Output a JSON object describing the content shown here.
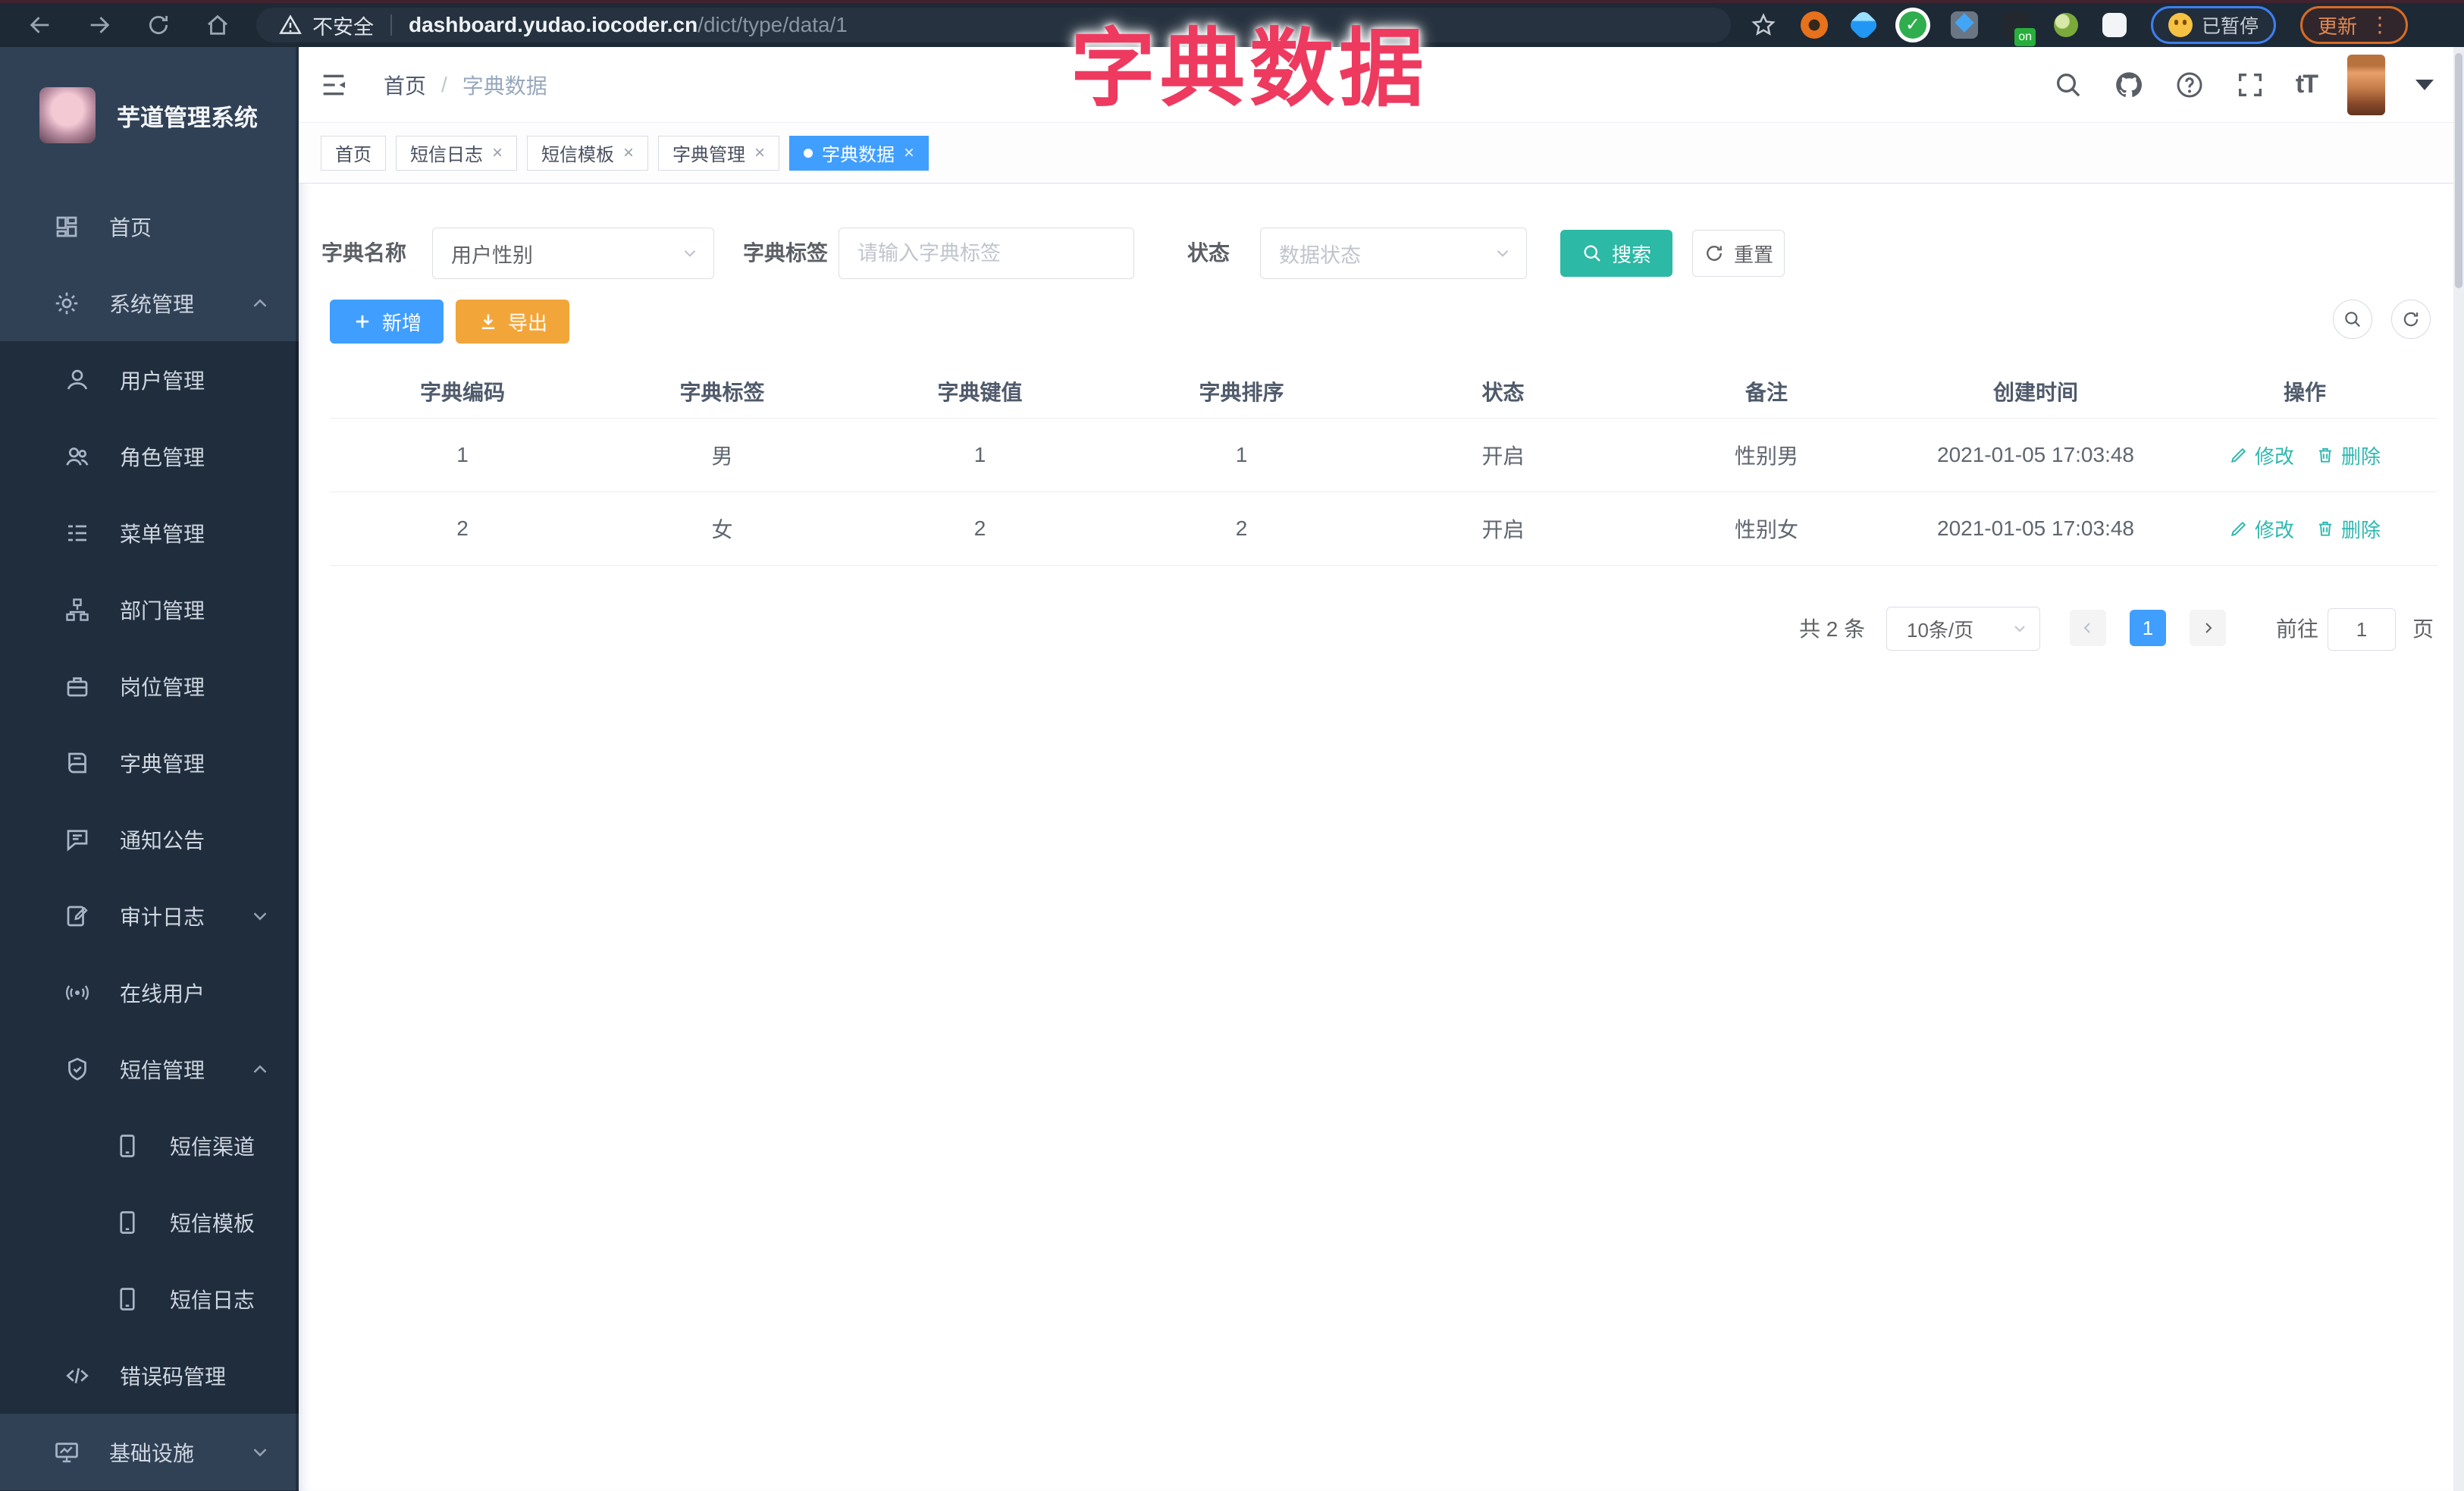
{
  "overlay_title": "字典数据",
  "browser": {
    "security": "不安全",
    "host": "dashboard.yudao.iocoder.cn",
    "path": "/dict/type/data/1",
    "paused": "已暂停",
    "update": "更新",
    "on_badge": "on"
  },
  "sidebar": {
    "title": "芋道管理系统",
    "items": [
      {
        "label": "首页"
      },
      {
        "label": "系统管理"
      },
      {
        "label": "用户管理"
      },
      {
        "label": "角色管理"
      },
      {
        "label": "菜单管理"
      },
      {
        "label": "部门管理"
      },
      {
        "label": "岗位管理"
      },
      {
        "label": "字典管理"
      },
      {
        "label": "通知公告"
      },
      {
        "label": "审计日志"
      },
      {
        "label": "在线用户"
      },
      {
        "label": "短信管理"
      },
      {
        "label": "短信渠道"
      },
      {
        "label": "短信模板"
      },
      {
        "label": "短信日志"
      },
      {
        "label": "错误码管理"
      },
      {
        "label": "基础设施"
      }
    ]
  },
  "header": {
    "breadcrumb_home": "首页",
    "breadcrumb_sep": "/",
    "breadcrumb_current": "字典数据"
  },
  "tabs": [
    {
      "label": "首页"
    },
    {
      "label": "短信日志"
    },
    {
      "label": "短信模板"
    },
    {
      "label": "字典管理"
    },
    {
      "label": "字典数据"
    }
  ],
  "filters": {
    "name_label": "字典名称",
    "name_value": "用户性别",
    "tag_label": "字典标签",
    "tag_placeholder": "请输入字典标签",
    "status_label": "状态",
    "status_placeholder": "数据状态",
    "search_label": "搜索",
    "reset_label": "重置"
  },
  "toolbar": {
    "add_label": "新增",
    "export_label": "导出"
  },
  "table": {
    "headers": [
      "字典编码",
      "字典标签",
      "字典键值",
      "字典排序",
      "状态",
      "备注",
      "创建时间",
      "操作"
    ],
    "rows": [
      {
        "code": "1",
        "tag": "男",
        "value": "1",
        "sort": "1",
        "status": "开启",
        "remark": "性别男",
        "created": "2021-01-05 17:03:48"
      },
      {
        "code": "2",
        "tag": "女",
        "value": "2",
        "sort": "2",
        "status": "开启",
        "remark": "性别女",
        "created": "2021-01-05 17:03:48"
      }
    ],
    "edit_label": "修改",
    "delete_label": "删除"
  },
  "pagination": {
    "total": "共 2 条",
    "page_size": "10条/页",
    "page": "1",
    "goto_label": "前往",
    "goto_value": "1",
    "page_unit": "页"
  },
  "colors": {
    "accent": "#409eff",
    "search_button": "#2cb9a5",
    "export_button": "#f2a63a",
    "action_link": "#2eb8b0",
    "sidebar_bg": "#304156",
    "submenu_bg": "#1f2d3d",
    "overlay_title": "#ee3a5f"
  }
}
